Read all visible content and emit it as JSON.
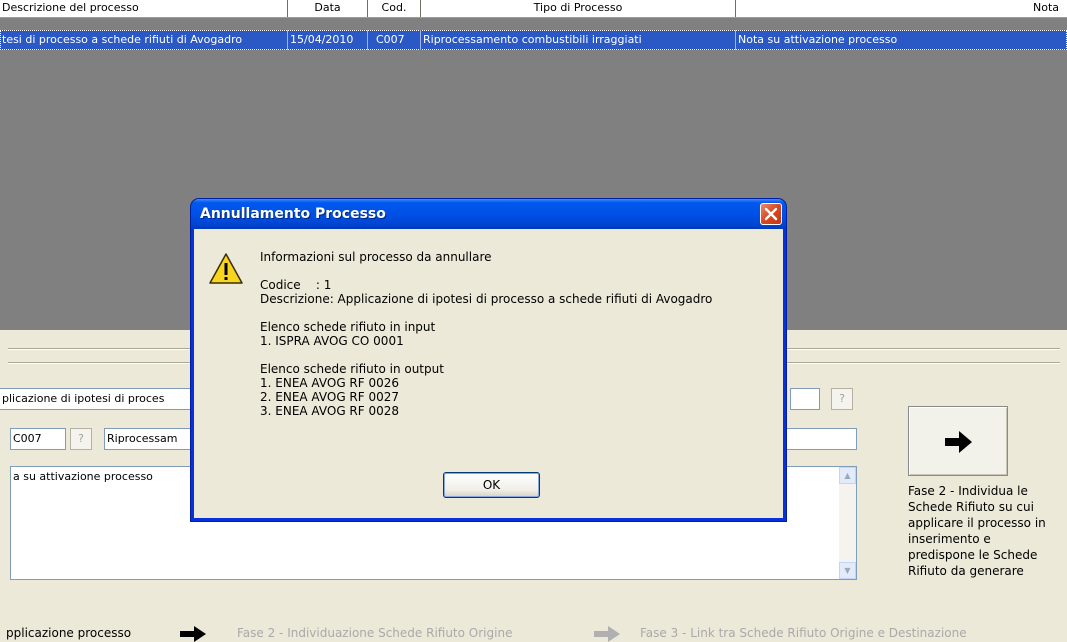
{
  "grid": {
    "columns": [
      "Descrizione del processo",
      "Data",
      "Cod.",
      "Tipo di Processo",
      "Nota"
    ],
    "row": {
      "descrizione": "tesi di processo a schede rifiuti di Avogadro",
      "data": "15/04/2010",
      "cod": "C007",
      "tipo": "Riprocessamento combustibili irraggiati",
      "nota": "Nota su attivazione processo"
    }
  },
  "form": {
    "descrizione_value": "plicazione di ipotesi di proces",
    "codice_value": "C007",
    "tipo_value": "Riprocessam",
    "help_label": "?",
    "note_value": "a su attivazione processo"
  },
  "next_step": {
    "description": "Fase 2 - Individua le Schede Rifiuto su cui applicare il processo in inserimento e predispone le Schede Rifiuto da generare"
  },
  "steps": {
    "current": "pplicazione processo",
    "step2": "Fase 2 - Individuazione Schede Rifiuto Origine",
    "step3": "Fase 3 - Link tra Schede Rifiuto Origine e Destinazione"
  },
  "dialog": {
    "title": "Annullamento Processo",
    "message": "Informazioni sul processo da annullare\n\nCodice    : 1\nDescrizione: Applicazione di ipotesi di processo a schede rifiuti di Avogadro\n\nElenco schede rifiuto in input\n1. ISPRA AVOG CO 0001\n\nElenco schede rifiuto in output\n1. ENEA AVOG RF 0026\n2. ENEA AVOG RF 0027\n3. ENEA AVOG RF 0028",
    "ok_label": "OK"
  },
  "colors": {
    "selection": "#2a58c4",
    "grid_background": "#808080",
    "titlebar": "#0054e3",
    "close_button": "#d8471e",
    "window_background": "#ece9d8"
  }
}
